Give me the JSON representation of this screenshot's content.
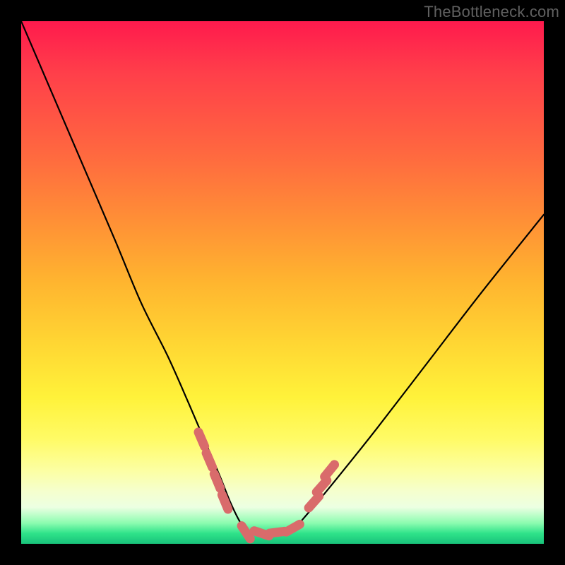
{
  "watermark": "TheBottleneck.com",
  "chart_data": {
    "type": "line",
    "title": "",
    "xlabel": "",
    "ylabel": "",
    "xlim": [
      0,
      100
    ],
    "ylim": [
      0,
      100
    ],
    "gradient_stops": [
      {
        "pct": 0,
        "color": "#ff1a4d"
      },
      {
        "pct": 50,
        "color": "#ffb52f"
      },
      {
        "pct": 80,
        "color": "#fffb66"
      },
      {
        "pct": 96,
        "color": "#8dfcb0"
      },
      {
        "pct": 100,
        "color": "#18c27a"
      }
    ],
    "series": [
      {
        "name": "bottleneck-curve",
        "x": [
          0,
          6,
          12,
          18,
          23,
          28,
          32,
          35,
          38,
          40,
          42,
          44,
          48,
          52,
          55,
          60,
          68,
          78,
          88,
          100
        ],
        "y": [
          100,
          86,
          72,
          58,
          46,
          36,
          27,
          20,
          13,
          8,
          4,
          2,
          2,
          3,
          6,
          12,
          22,
          35,
          48,
          63
        ]
      }
    ],
    "markers": {
      "name": "highlight-dots",
      "color": "#d96b6b",
      "points": [
        {
          "x": 34.5,
          "y": 20
        },
        {
          "x": 36.0,
          "y": 16
        },
        {
          "x": 37.5,
          "y": 12
        },
        {
          "x": 39.0,
          "y": 8
        },
        {
          "x": 43.0,
          "y": 2.2
        },
        {
          "x": 46.0,
          "y": 2.0
        },
        {
          "x": 49.0,
          "y": 2.2
        },
        {
          "x": 52.0,
          "y": 3.0
        },
        {
          "x": 56.0,
          "y": 8
        },
        {
          "x": 57.5,
          "y": 11
        },
        {
          "x": 59.0,
          "y": 14
        }
      ]
    },
    "curve_minimum": {
      "x_approx": 46,
      "y_approx": 2
    }
  }
}
